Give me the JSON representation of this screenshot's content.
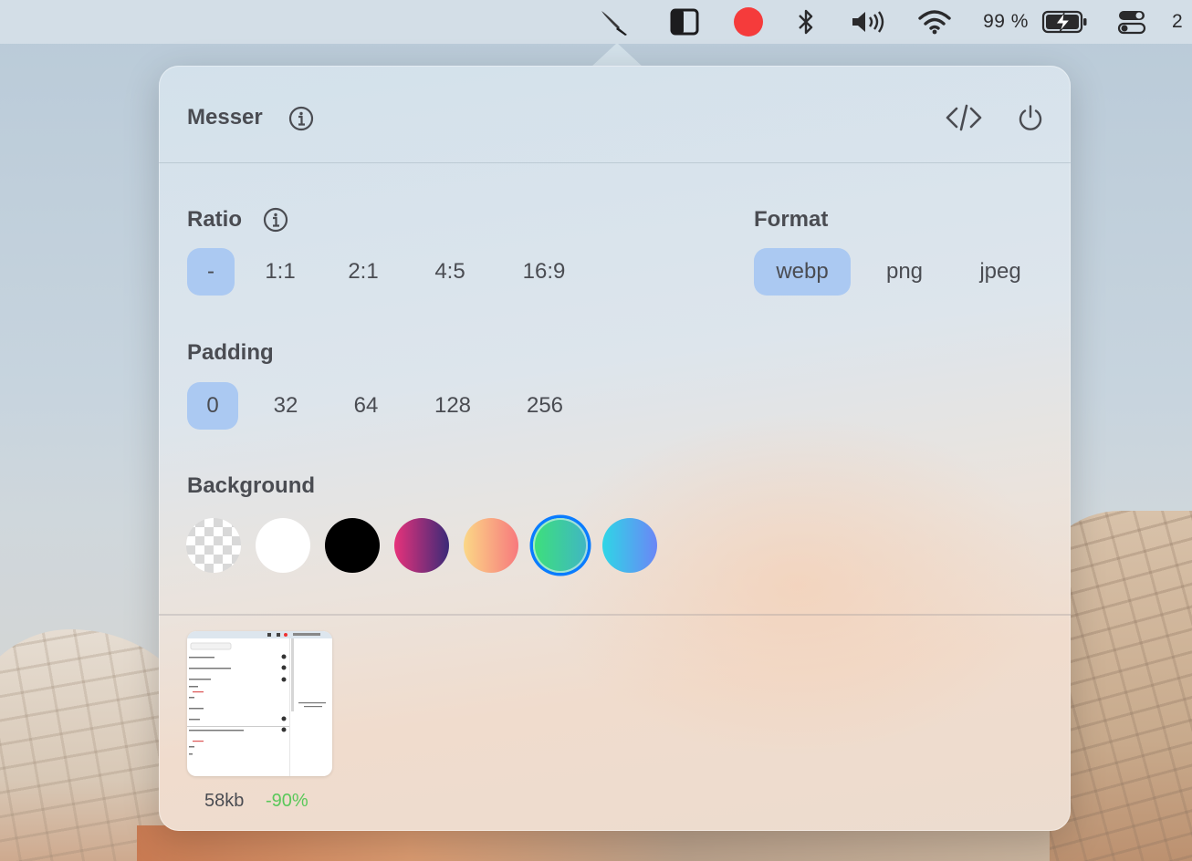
{
  "menubar": {
    "battery_percent": "99 %",
    "clock_partial": "2",
    "icons": [
      "knife-icon",
      "sidebar-icon",
      "record-icon",
      "bluetooth-icon",
      "volume-icon",
      "wifi-icon",
      "battery-charging-icon",
      "control-center-icon"
    ]
  },
  "popover": {
    "title": "Messer",
    "ratio": {
      "label": "Ratio",
      "options": [
        "-",
        "1:1",
        "2:1",
        "4:5",
        "16:9"
      ],
      "selected": "-"
    },
    "format": {
      "label": "Format",
      "options": [
        "webp",
        "png",
        "jpeg"
      ],
      "selected": "webp"
    },
    "padding": {
      "label": "Padding",
      "options": [
        "0",
        "32",
        "64",
        "128",
        "256"
      ],
      "selected": "0"
    },
    "background": {
      "label": "Background",
      "swatches": [
        {
          "name": "transparent",
          "colors": [
            "#d8d8d8",
            "#ffffff"
          ]
        },
        {
          "name": "white",
          "colors": [
            "#ffffff"
          ]
        },
        {
          "name": "black",
          "colors": [
            "#000000"
          ]
        },
        {
          "name": "pink-purple",
          "colors": [
            "#e7327a",
            "#3b2a78"
          ]
        },
        {
          "name": "yellow-pink",
          "colors": [
            "#fbd786",
            "#f7797d"
          ]
        },
        {
          "name": "green-teal",
          "colors": [
            "#3ee07a",
            "#3fb6c4"
          ]
        },
        {
          "name": "cyan-blue",
          "colors": [
            "#2fd6e6",
            "#6a86f6"
          ]
        }
      ],
      "selected": "green-teal",
      "selected_ring_color": "#0a7cff"
    },
    "result": {
      "size": "58kb",
      "saving": "-90%",
      "saving_color": "#5ac85a"
    }
  }
}
